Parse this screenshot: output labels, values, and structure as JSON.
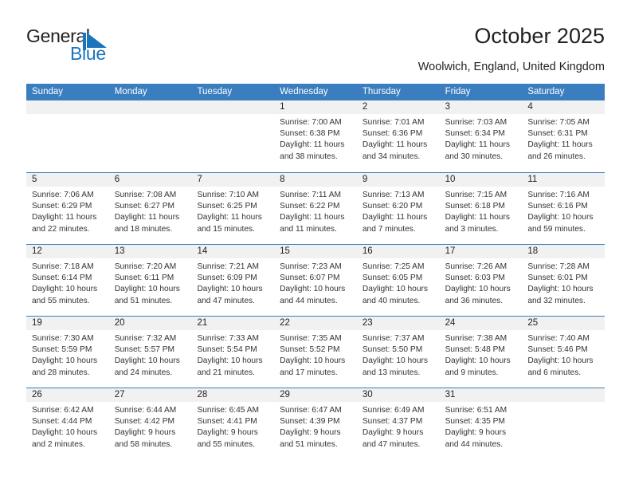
{
  "brand": {
    "name_part1": "General",
    "name_part2": "Blue"
  },
  "header": {
    "title": "October 2025",
    "location": "Woolwich, England, United Kingdom"
  },
  "calendar": {
    "weekdays": [
      "Sunday",
      "Monday",
      "Tuesday",
      "Wednesday",
      "Thursday",
      "Friday",
      "Saturday"
    ],
    "labels": {
      "sunrise": "Sunrise:",
      "sunset": "Sunset:",
      "daylight": "Daylight:"
    },
    "accent_color": "#3b7ebf",
    "daynumber_bg": "#f1f1f1",
    "weeks": [
      [
        {
          "day": "",
          "empty": true
        },
        {
          "day": "",
          "empty": true
        },
        {
          "day": "",
          "empty": true
        },
        {
          "day": "1",
          "sunrise": "Sunrise: 7:00 AM",
          "sunset": "Sunset: 6:38 PM",
          "daylight1": "Daylight: 11 hours",
          "daylight2": "and 38 minutes."
        },
        {
          "day": "2",
          "sunrise": "Sunrise: 7:01 AM",
          "sunset": "Sunset: 6:36 PM",
          "daylight1": "Daylight: 11 hours",
          "daylight2": "and 34 minutes."
        },
        {
          "day": "3",
          "sunrise": "Sunrise: 7:03 AM",
          "sunset": "Sunset: 6:34 PM",
          "daylight1": "Daylight: 11 hours",
          "daylight2": "and 30 minutes."
        },
        {
          "day": "4",
          "sunrise": "Sunrise: 7:05 AM",
          "sunset": "Sunset: 6:31 PM",
          "daylight1": "Daylight: 11 hours",
          "daylight2": "and 26 minutes."
        }
      ],
      [
        {
          "day": "5",
          "sunrise": "Sunrise: 7:06 AM",
          "sunset": "Sunset: 6:29 PM",
          "daylight1": "Daylight: 11 hours",
          "daylight2": "and 22 minutes."
        },
        {
          "day": "6",
          "sunrise": "Sunrise: 7:08 AM",
          "sunset": "Sunset: 6:27 PM",
          "daylight1": "Daylight: 11 hours",
          "daylight2": "and 18 minutes."
        },
        {
          "day": "7",
          "sunrise": "Sunrise: 7:10 AM",
          "sunset": "Sunset: 6:25 PM",
          "daylight1": "Daylight: 11 hours",
          "daylight2": "and 15 minutes."
        },
        {
          "day": "8",
          "sunrise": "Sunrise: 7:11 AM",
          "sunset": "Sunset: 6:22 PM",
          "daylight1": "Daylight: 11 hours",
          "daylight2": "and 11 minutes."
        },
        {
          "day": "9",
          "sunrise": "Sunrise: 7:13 AM",
          "sunset": "Sunset: 6:20 PM",
          "daylight1": "Daylight: 11 hours",
          "daylight2": "and 7 minutes."
        },
        {
          "day": "10",
          "sunrise": "Sunrise: 7:15 AM",
          "sunset": "Sunset: 6:18 PM",
          "daylight1": "Daylight: 11 hours",
          "daylight2": "and 3 minutes."
        },
        {
          "day": "11",
          "sunrise": "Sunrise: 7:16 AM",
          "sunset": "Sunset: 6:16 PM",
          "daylight1": "Daylight: 10 hours",
          "daylight2": "and 59 minutes."
        }
      ],
      [
        {
          "day": "12",
          "sunrise": "Sunrise: 7:18 AM",
          "sunset": "Sunset: 6:14 PM",
          "daylight1": "Daylight: 10 hours",
          "daylight2": "and 55 minutes."
        },
        {
          "day": "13",
          "sunrise": "Sunrise: 7:20 AM",
          "sunset": "Sunset: 6:11 PM",
          "daylight1": "Daylight: 10 hours",
          "daylight2": "and 51 minutes."
        },
        {
          "day": "14",
          "sunrise": "Sunrise: 7:21 AM",
          "sunset": "Sunset: 6:09 PM",
          "daylight1": "Daylight: 10 hours",
          "daylight2": "and 47 minutes."
        },
        {
          "day": "15",
          "sunrise": "Sunrise: 7:23 AM",
          "sunset": "Sunset: 6:07 PM",
          "daylight1": "Daylight: 10 hours",
          "daylight2": "and 44 minutes."
        },
        {
          "day": "16",
          "sunrise": "Sunrise: 7:25 AM",
          "sunset": "Sunset: 6:05 PM",
          "daylight1": "Daylight: 10 hours",
          "daylight2": "and 40 minutes."
        },
        {
          "day": "17",
          "sunrise": "Sunrise: 7:26 AM",
          "sunset": "Sunset: 6:03 PM",
          "daylight1": "Daylight: 10 hours",
          "daylight2": "and 36 minutes."
        },
        {
          "day": "18",
          "sunrise": "Sunrise: 7:28 AM",
          "sunset": "Sunset: 6:01 PM",
          "daylight1": "Daylight: 10 hours",
          "daylight2": "and 32 minutes."
        }
      ],
      [
        {
          "day": "19",
          "sunrise": "Sunrise: 7:30 AM",
          "sunset": "Sunset: 5:59 PM",
          "daylight1": "Daylight: 10 hours",
          "daylight2": "and 28 minutes."
        },
        {
          "day": "20",
          "sunrise": "Sunrise: 7:32 AM",
          "sunset": "Sunset: 5:57 PM",
          "daylight1": "Daylight: 10 hours",
          "daylight2": "and 24 minutes."
        },
        {
          "day": "21",
          "sunrise": "Sunrise: 7:33 AM",
          "sunset": "Sunset: 5:54 PM",
          "daylight1": "Daylight: 10 hours",
          "daylight2": "and 21 minutes."
        },
        {
          "day": "22",
          "sunrise": "Sunrise: 7:35 AM",
          "sunset": "Sunset: 5:52 PM",
          "daylight1": "Daylight: 10 hours",
          "daylight2": "and 17 minutes."
        },
        {
          "day": "23",
          "sunrise": "Sunrise: 7:37 AM",
          "sunset": "Sunset: 5:50 PM",
          "daylight1": "Daylight: 10 hours",
          "daylight2": "and 13 minutes."
        },
        {
          "day": "24",
          "sunrise": "Sunrise: 7:38 AM",
          "sunset": "Sunset: 5:48 PM",
          "daylight1": "Daylight: 10 hours",
          "daylight2": "and 9 minutes."
        },
        {
          "day": "25",
          "sunrise": "Sunrise: 7:40 AM",
          "sunset": "Sunset: 5:46 PM",
          "daylight1": "Daylight: 10 hours",
          "daylight2": "and 6 minutes."
        }
      ],
      [
        {
          "day": "26",
          "sunrise": "Sunrise: 6:42 AM",
          "sunset": "Sunset: 4:44 PM",
          "daylight1": "Daylight: 10 hours",
          "daylight2": "and 2 minutes."
        },
        {
          "day": "27",
          "sunrise": "Sunrise: 6:44 AM",
          "sunset": "Sunset: 4:42 PM",
          "daylight1": "Daylight: 9 hours",
          "daylight2": "and 58 minutes."
        },
        {
          "day": "28",
          "sunrise": "Sunrise: 6:45 AM",
          "sunset": "Sunset: 4:41 PM",
          "daylight1": "Daylight: 9 hours",
          "daylight2": "and 55 minutes."
        },
        {
          "day": "29",
          "sunrise": "Sunrise: 6:47 AM",
          "sunset": "Sunset: 4:39 PM",
          "daylight1": "Daylight: 9 hours",
          "daylight2": "and 51 minutes."
        },
        {
          "day": "30",
          "sunrise": "Sunrise: 6:49 AM",
          "sunset": "Sunset: 4:37 PM",
          "daylight1": "Daylight: 9 hours",
          "daylight2": "and 47 minutes."
        },
        {
          "day": "31",
          "sunrise": "Sunrise: 6:51 AM",
          "sunset": "Sunset: 4:35 PM",
          "daylight1": "Daylight: 9 hours",
          "daylight2": "and 44 minutes."
        },
        {
          "day": "",
          "empty": true
        }
      ]
    ]
  }
}
